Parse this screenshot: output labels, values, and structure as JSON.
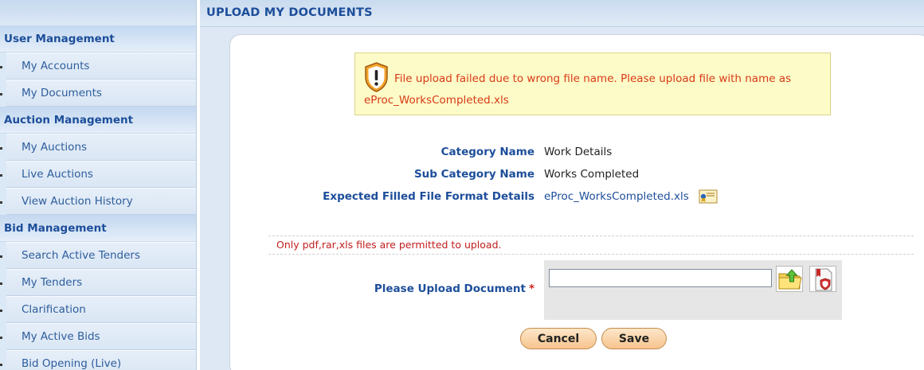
{
  "sidebar": {
    "sections": [
      {
        "title": "User Management",
        "items": [
          "My Accounts",
          "My Documents"
        ]
      },
      {
        "title": "Auction Management",
        "items": [
          "My Auctions",
          "Live Auctions",
          "View Auction History"
        ]
      },
      {
        "title": "Bid Management",
        "items": [
          "Search Active Tenders",
          "My Tenders",
          "Clarification",
          "My Active Bids",
          "Bid Opening (Live)"
        ]
      }
    ]
  },
  "page": {
    "title": "UPLOAD MY DOCUMENTS"
  },
  "error": {
    "line1": "File upload failed due to wrong file name. Please upload file with name as",
    "line2": "eProc_WorksCompleted.xls"
  },
  "details": {
    "category_label": "Category Name",
    "category_value": "Work Details",
    "subcategory_label": "Sub Category Name",
    "subcategory_value": "Works Completed",
    "format_label": "Expected Filled File Format Details",
    "format_value": "eProc_WorksCompleted.xls"
  },
  "note": "Only pdf,rar,xls files are permitted to upload.",
  "upload": {
    "label": "Please Upload Document",
    "required": "*",
    "value": ""
  },
  "buttons": {
    "cancel": "Cancel",
    "save": "Save"
  },
  "icons": {
    "warning": "warning-shield-icon",
    "format_info": "certificate-icon",
    "browse": "folder-upload-icon",
    "remove": "pdf-shield-icon"
  },
  "colors": {
    "heading_blue": "#1d4e9a",
    "error_red": "#d83a16",
    "error_bg": "#fdfbc8",
    "note_red": "#c21e1e",
    "button_orange": "#f7c48e"
  }
}
